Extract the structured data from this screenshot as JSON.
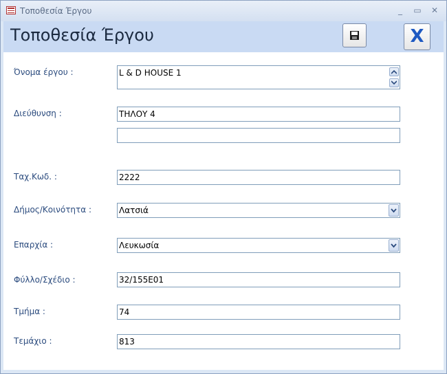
{
  "window": {
    "title": "Τοποθεσία Έργου",
    "minimize_glyph": "_",
    "maximize_glyph": "▭",
    "close_glyph": "✕"
  },
  "header": {
    "form_title": "Τοποθεσία Έργου",
    "save_icon": "save-icon",
    "close_label": "X"
  },
  "form": {
    "project_name": {
      "label": "Όνομα έργου :",
      "value": "L & D HOUSE 1"
    },
    "address": {
      "label": "Διεύθυνση :",
      "value_line1": "ΤΗΛΟΥ 4",
      "value_line2": ""
    },
    "postal_code": {
      "label": "Ταχ.Κωδ. :",
      "value": "2222"
    },
    "municipality": {
      "label": "Δήμος/Κοινότητα :",
      "value": "Λατσιά"
    },
    "district": {
      "label": "Επαρχία :",
      "value": "Λευκωσία"
    },
    "sheet_plan": {
      "label": "Φύλλο/Σχέδιο :",
      "value": "32/155E01"
    },
    "section": {
      "label": "Τμήμα :",
      "value": "74"
    },
    "plot": {
      "label": "Τεμάχιο :",
      "value": "813"
    }
  },
  "colors": {
    "label": "#2b4b7e",
    "header_bg": "#c9daf3",
    "close_x": "#1f5ac2",
    "field_border": "#7f9db9"
  }
}
